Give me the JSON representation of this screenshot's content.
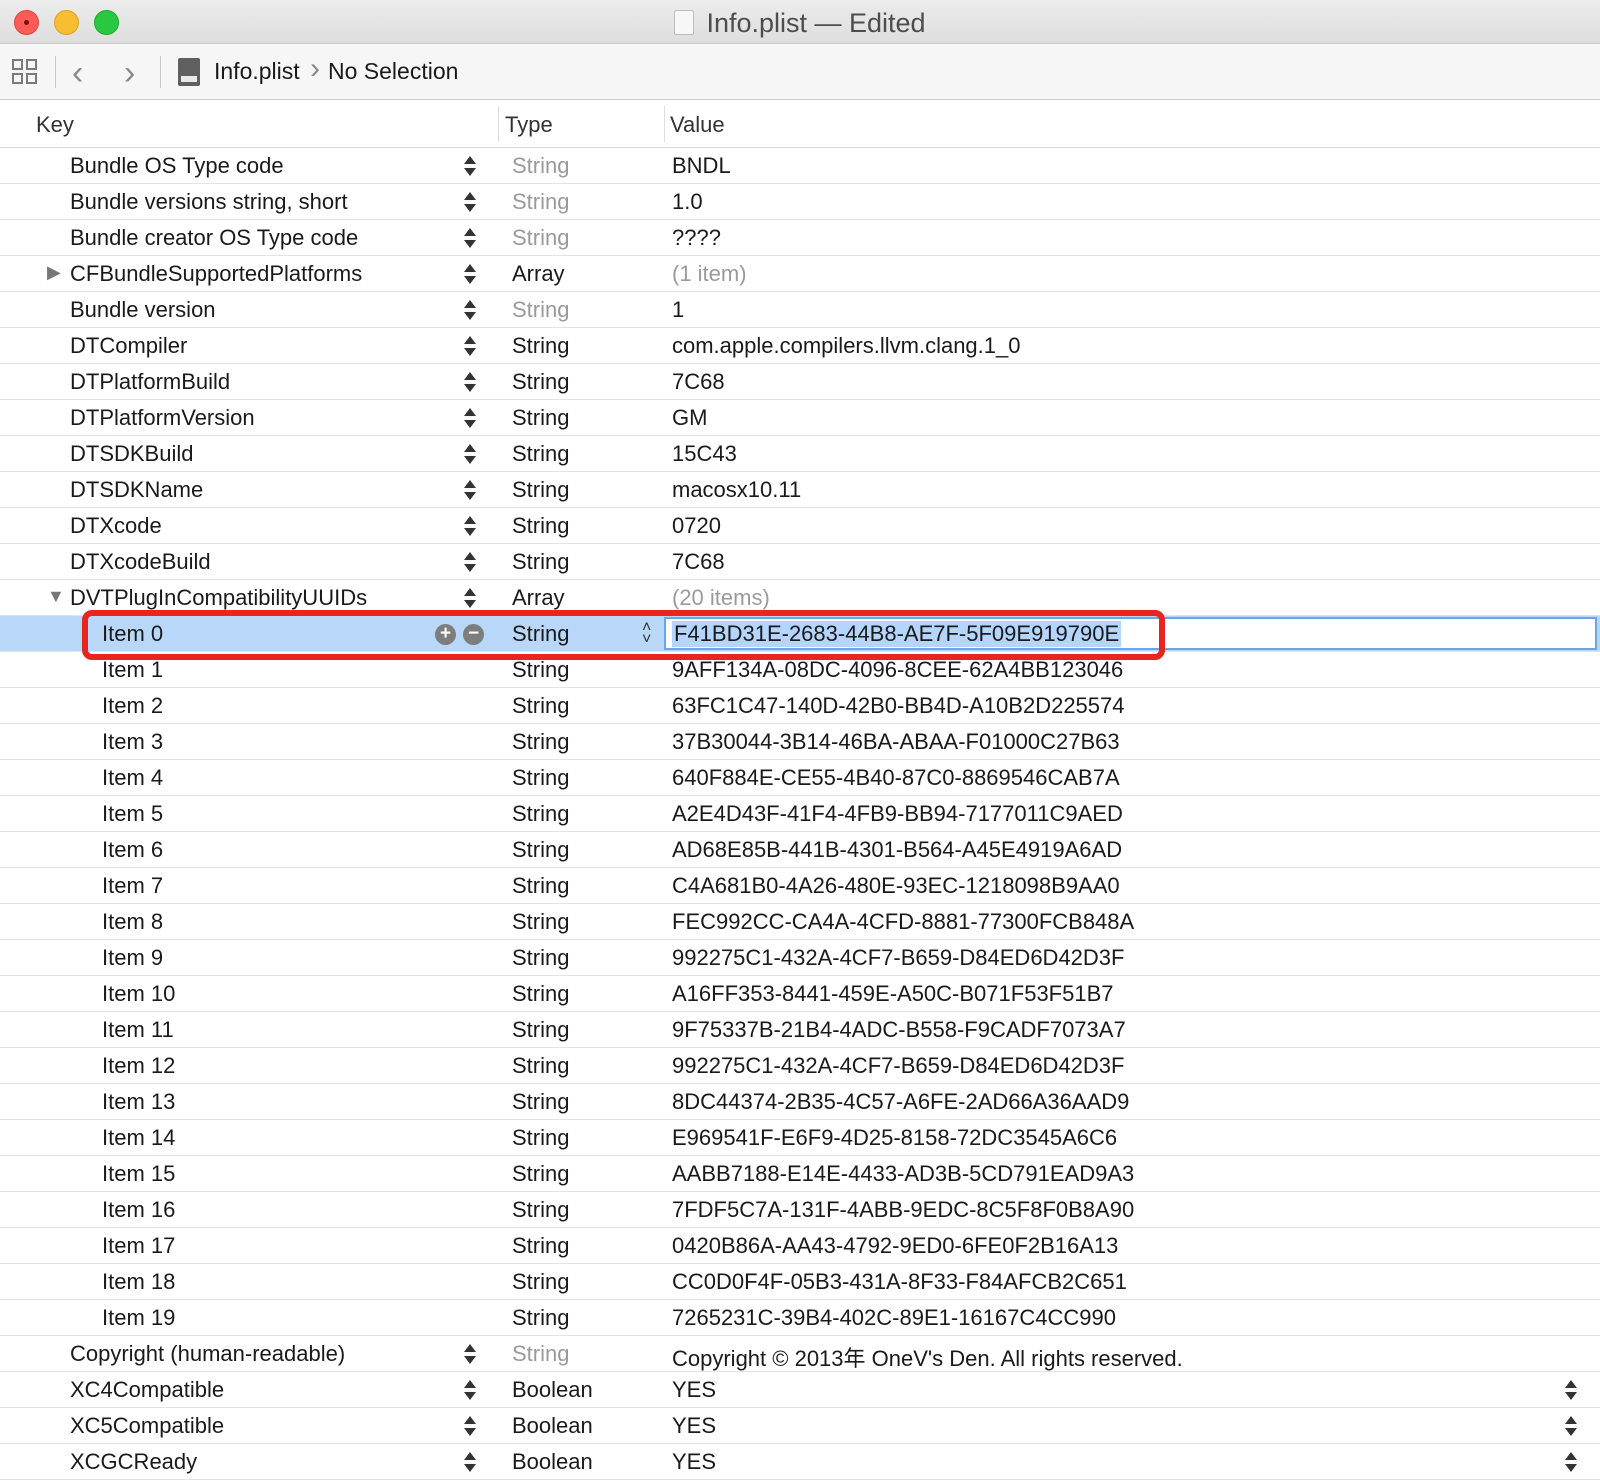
{
  "window": {
    "title": "Info.plist — Edited"
  },
  "jumpbar": {
    "file": "Info.plist",
    "selection": "No Selection"
  },
  "columns": {
    "key": "Key",
    "type": "Type",
    "value": "Value"
  },
  "icons": {
    "grid": "related-items-grid-icon",
    "back": "chevron-left-icon",
    "forward": "chevron-right-icon",
    "file": "plist-file-icon"
  },
  "rows": [
    {
      "key": "Bundle OS Type code",
      "type": "String",
      "value": "BNDL",
      "level": 0,
      "type_dim": true
    },
    {
      "key": "Bundle versions string, short",
      "type": "String",
      "value": "1.0",
      "level": 0,
      "type_dim": true
    },
    {
      "key": "Bundle creator OS Type code",
      "type": "String",
      "value": "????",
      "level": 0,
      "type_dim": true
    },
    {
      "key": "CFBundleSupportedPlatforms",
      "type": "Array",
      "value": "(1 item)",
      "level": 0,
      "disclosure": "collapsed",
      "value_dim": true
    },
    {
      "key": "Bundle version",
      "type": "String",
      "value": "1",
      "level": 0,
      "type_dim": true
    },
    {
      "key": "DTCompiler",
      "type": "String",
      "value": "com.apple.compilers.llvm.clang.1_0",
      "level": 0
    },
    {
      "key": "DTPlatformBuild",
      "type": "String",
      "value": "7C68",
      "level": 0
    },
    {
      "key": "DTPlatformVersion",
      "type": "String",
      "value": "GM",
      "level": 0
    },
    {
      "key": "DTSDKBuild",
      "type": "String",
      "value": "15C43",
      "level": 0
    },
    {
      "key": "DTSDKName",
      "type": "String",
      "value": "macosx10.11",
      "level": 0
    },
    {
      "key": "DTXcode",
      "type": "String",
      "value": "0720",
      "level": 0
    },
    {
      "key": "DTXcodeBuild",
      "type": "String",
      "value": "7C68",
      "level": 0
    },
    {
      "key": "DVTPlugInCompatibilityUUIDs",
      "type": "Array",
      "value": "(20 items)",
      "level": 0,
      "disclosure": "expanded",
      "value_dim": true
    },
    {
      "key": "Item 0",
      "type": "String",
      "value": "F41BD31E-2683-44B8-AE7F-5F09E919790E",
      "level": 1,
      "selected": true
    },
    {
      "key": "Item 1",
      "type": "String",
      "value": "9AFF134A-08DC-4096-8CEE-62A4BB123046",
      "level": 1
    },
    {
      "key": "Item 2",
      "type": "String",
      "value": "63FC1C47-140D-42B0-BB4D-A10B2D225574",
      "level": 1
    },
    {
      "key": "Item 3",
      "type": "String",
      "value": "37B30044-3B14-46BA-ABAA-F01000C27B63",
      "level": 1
    },
    {
      "key": "Item 4",
      "type": "String",
      "value": "640F884E-CE55-4B40-87C0-8869546CAB7A",
      "level": 1
    },
    {
      "key": "Item 5",
      "type": "String",
      "value": "A2E4D43F-41F4-4FB9-BB94-7177011C9AED",
      "level": 1
    },
    {
      "key": "Item 6",
      "type": "String",
      "value": "AD68E85B-441B-4301-B564-A45E4919A6AD",
      "level": 1
    },
    {
      "key": "Item 7",
      "type": "String",
      "value": "C4A681B0-4A26-480E-93EC-1218098B9AA0",
      "level": 1
    },
    {
      "key": "Item 8",
      "type": "String",
      "value": "FEC992CC-CA4A-4CFD-8881-77300FCB848A",
      "level": 1
    },
    {
      "key": "Item 9",
      "type": "String",
      "value": "992275C1-432A-4CF7-B659-D84ED6D42D3F",
      "level": 1
    },
    {
      "key": "Item 10",
      "type": "String",
      "value": "A16FF353-8441-459E-A50C-B071F53F51B7",
      "level": 1
    },
    {
      "key": "Item 11",
      "type": "String",
      "value": "9F75337B-21B4-4ADC-B558-F9CADF7073A7",
      "level": 1
    },
    {
      "key": "Item 12",
      "type": "String",
      "value": "992275C1-432A-4CF7-B659-D84ED6D42D3F",
      "level": 1
    },
    {
      "key": "Item 13",
      "type": "String",
      "value": "8DC44374-2B35-4C57-A6FE-2AD66A36AAD9",
      "level": 1
    },
    {
      "key": "Item 14",
      "type": "String",
      "value": "E969541F-E6F9-4D25-8158-72DC3545A6C6",
      "level": 1
    },
    {
      "key": "Item 15",
      "type": "String",
      "value": "AABB7188-E14E-4433-AD3B-5CD791EAD9A3",
      "level": 1
    },
    {
      "key": "Item 16",
      "type": "String",
      "value": "7FDF5C7A-131F-4ABB-9EDC-8C5F8F0B8A90",
      "level": 1
    },
    {
      "key": "Item 17",
      "type": "String",
      "value": "0420B86A-AA43-4792-9ED0-6FE0F2B16A13",
      "level": 1
    },
    {
      "key": "Item 18",
      "type": "String",
      "value": "CC0D0F4F-05B3-431A-8F33-F84AFCB2C651",
      "level": 1
    },
    {
      "key": "Item 19",
      "type": "String",
      "value": "7265231C-39B4-402C-89E1-16167C4CC990",
      "level": 1
    },
    {
      "key": "Copyright (human-readable)",
      "type": "String",
      "value": "Copyright © 2013年 OneV's Den. All rights reserved.",
      "level": 0,
      "type_dim": true
    },
    {
      "key": "XC4Compatible",
      "type": "Boolean",
      "value": "YES",
      "level": 0,
      "value_stepper": true
    },
    {
      "key": "XC5Compatible",
      "type": "Boolean",
      "value": "YES",
      "level": 0,
      "value_stepper": true
    },
    {
      "key": "XCGCReady",
      "type": "Boolean",
      "value": "YES",
      "level": 0,
      "value_stepper": true
    }
  ],
  "colors": {
    "selection": "#b9d7f9",
    "annotation_box": "#e8261f"
  }
}
